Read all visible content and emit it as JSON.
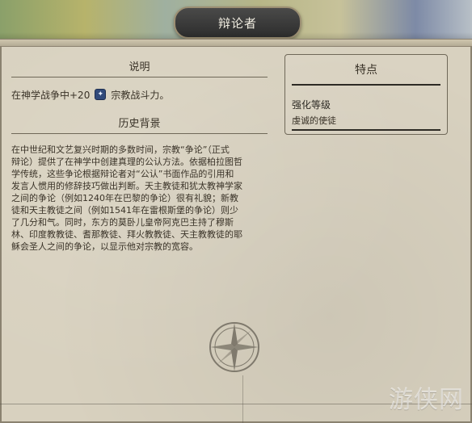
{
  "window": {
    "title": "辩论者"
  },
  "sections": {
    "description_title": "说明",
    "effect_prefix": "在神学战争中+20",
    "effect_suffix": "宗教战斗力。",
    "history_title": "历史背景",
    "history_text": "在中世纪和文艺复兴时期的多数时间，宗教“争论”（正式\n辩论）提供了在神学中创建真理的公认方法。依据柏拉图哲\n学传统，这些争论根据辩论者对“公认”书面作品的引用和\n发言人惯用的修辞技巧做出判断。天主教徒和犹太教神学家\n之间的争论（例如1240年在巴黎的争论）很有礼貌；新教\n徒和天主教徒之间（例如1541年在雷根斯堡的争论）则少\n了几分和气。同时，东方的莫卧儿皇帝阿克巴主持了穆斯\n林、印度教教徒、耆那教徒、拜火教教徒、天主教教徒的耶\n稣会圣人之间的争论，以显示他对宗教的宽容。"
  },
  "traits": {
    "title": "特点",
    "promotion_name": "强化等级",
    "promotion_desc": "虔诚的使徒"
  },
  "icons": {
    "faith": "faith-icon",
    "compass": "compass-rose-icon"
  },
  "watermark": {
    "text": "游侠网"
  },
  "colors": {
    "parchment": "#d8d1bf",
    "text": "#3a3328",
    "title_plate": "#2d2d2d"
  }
}
